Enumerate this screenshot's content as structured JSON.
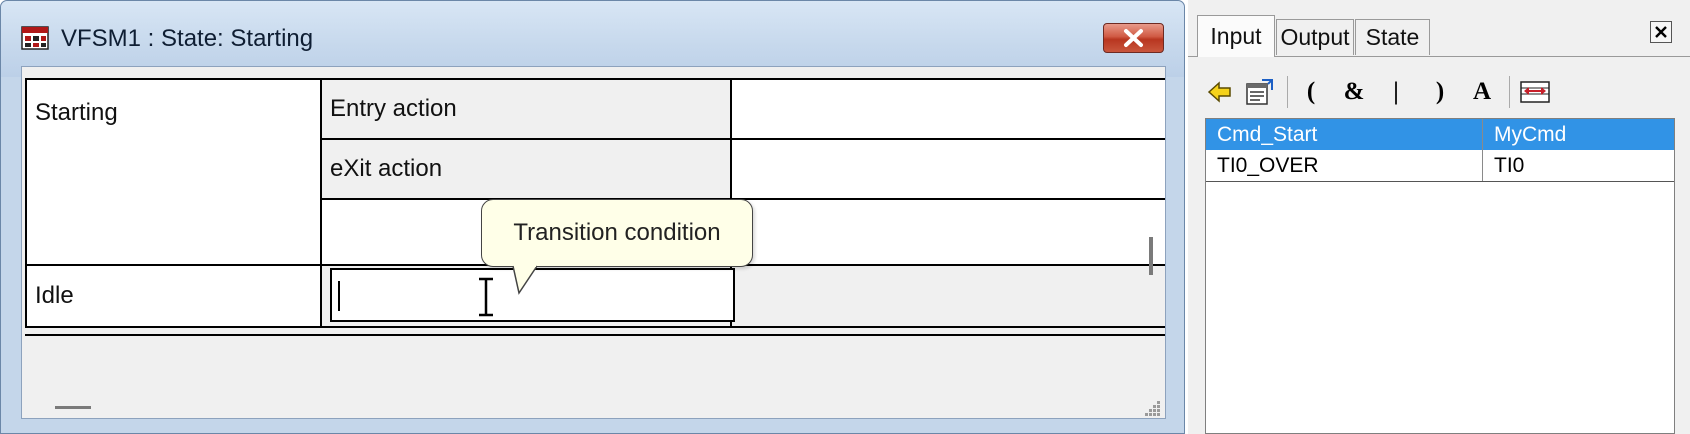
{
  "window": {
    "title": "VFSM1 : State: Starting",
    "close_label": "X"
  },
  "state_table": {
    "state_name": "Starting",
    "entry_action_label": "Entry action",
    "exit_action_label": "eXit action",
    "next_state": "Idle",
    "condition_value": ""
  },
  "tooltip": {
    "text": "Transition condition"
  },
  "panel": {
    "tabs": [
      {
        "label": "Input",
        "active": true
      },
      {
        "label": "Output",
        "active": false
      },
      {
        "label": "State",
        "active": false
      }
    ],
    "close_label": "X",
    "toolbar": {
      "back_icon": "arrow-left-icon",
      "properties_icon": "properties-icon",
      "open_paren": "(",
      "and": "&",
      "or": "|",
      "close_paren": ")",
      "text": "A",
      "resize_icon": "fit-width-icon"
    },
    "list": {
      "rows": [
        {
          "name": "Cmd_Start",
          "value": "MyCmd",
          "selected": true
        },
        {
          "name": "TI0_OVER",
          "value": "TI0",
          "selected": false
        }
      ]
    }
  },
  "colors": {
    "selection": "#3193e6",
    "tooltip_bg": "#ffffe8",
    "frame": "#c4d6ea"
  }
}
